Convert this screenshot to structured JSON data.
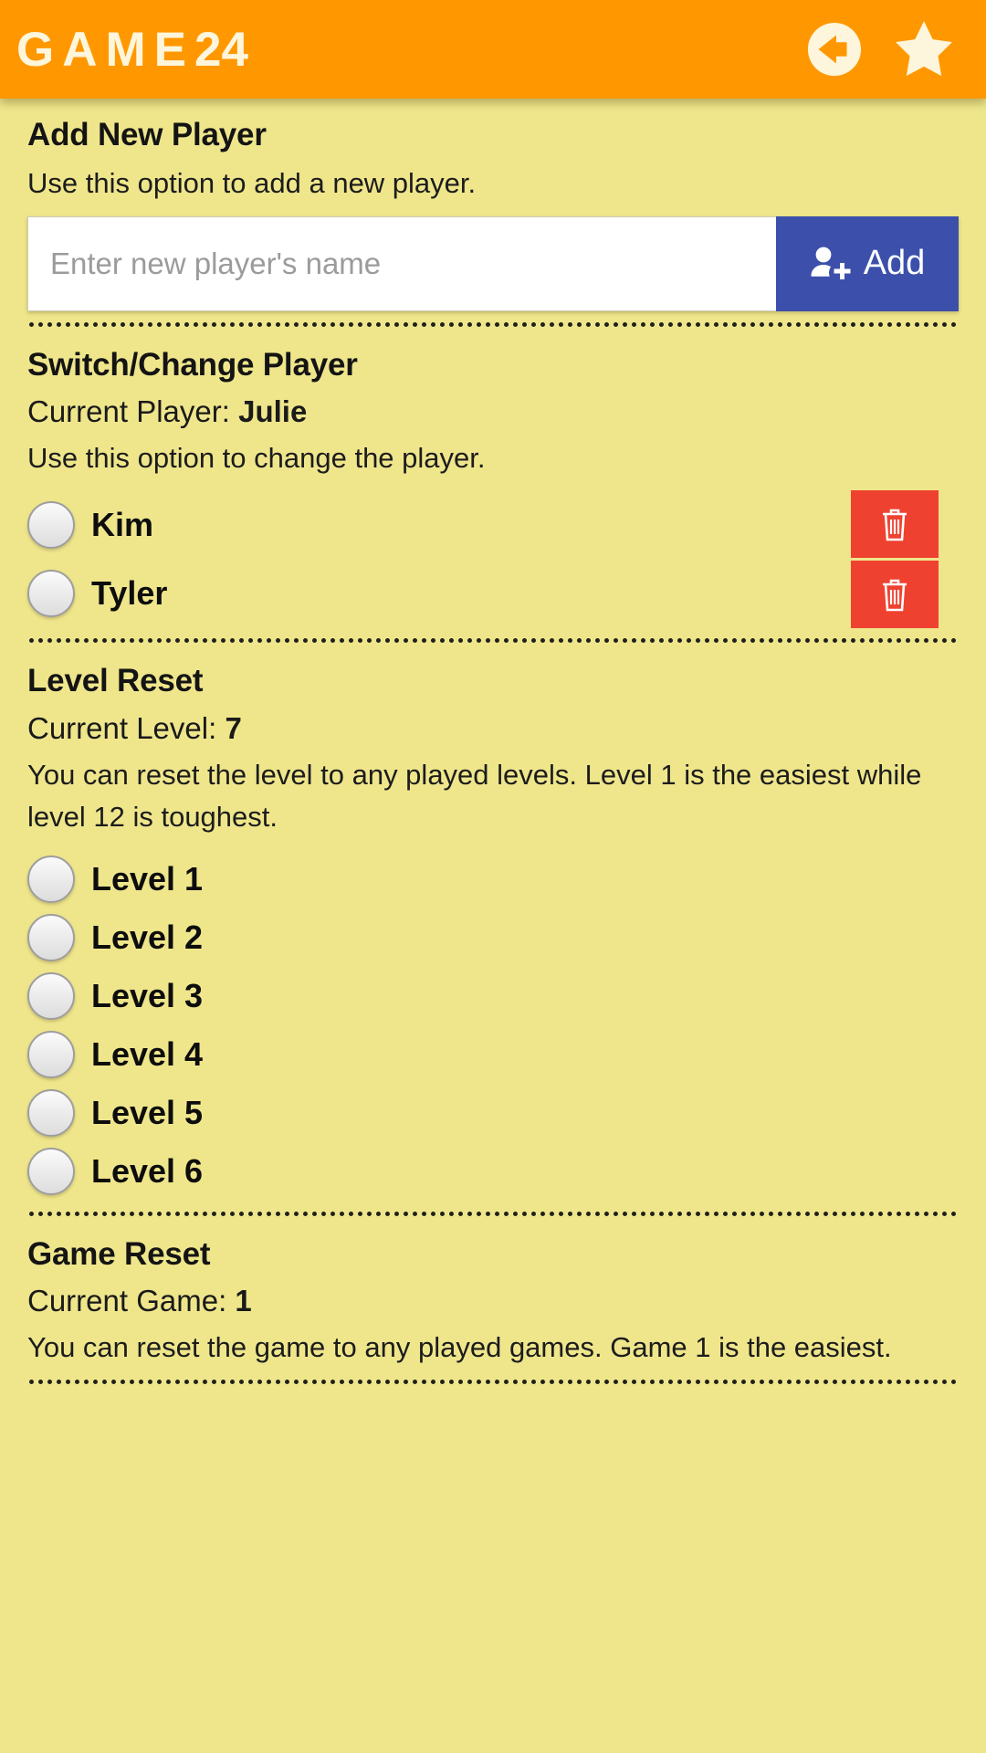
{
  "header": {
    "title_main": "GAME",
    "title_number": "24",
    "back_icon": "back-arrow-circle-icon",
    "favorite_icon": "star-icon",
    "background_color": "#ff9800",
    "text_color": "#fdf6dc"
  },
  "page": {
    "background_color": "#efe68c"
  },
  "add_player": {
    "title": "Add New Player",
    "description": "Use this option to add a new player.",
    "input_value": "",
    "input_placeholder": "Enter new player's name",
    "add_button_label": "Add",
    "add_button_icon": "user-plus-icon",
    "add_button_color": "#3c50ab"
  },
  "switch_player": {
    "title": "Switch/Change Player",
    "current_label": "Current Player:",
    "current_value": "Julie",
    "description": "Use this option to change the player.",
    "delete_icon": "trash-icon",
    "delete_button_color": "#ef4130",
    "players": [
      {
        "name": "Kim",
        "selected": false
      },
      {
        "name": "Tyler",
        "selected": false
      }
    ]
  },
  "level_reset": {
    "title": "Level Reset",
    "current_label": "Current Level:",
    "current_value": "7",
    "description": "You can reset the level to any played levels. Level 1 is the easiest while level 12 is toughest.",
    "levels": [
      {
        "label": "Level 1",
        "selected": false
      },
      {
        "label": "Level 2",
        "selected": false
      },
      {
        "label": "Level 3",
        "selected": false
      },
      {
        "label": "Level 4",
        "selected": false
      },
      {
        "label": "Level 5",
        "selected": false
      },
      {
        "label": "Level 6",
        "selected": false
      }
    ]
  },
  "game_reset": {
    "title": "Game Reset",
    "current_label": "Current Game:",
    "current_value": "1",
    "description": "You can reset the game to any played games. Game 1 is the easiest."
  }
}
